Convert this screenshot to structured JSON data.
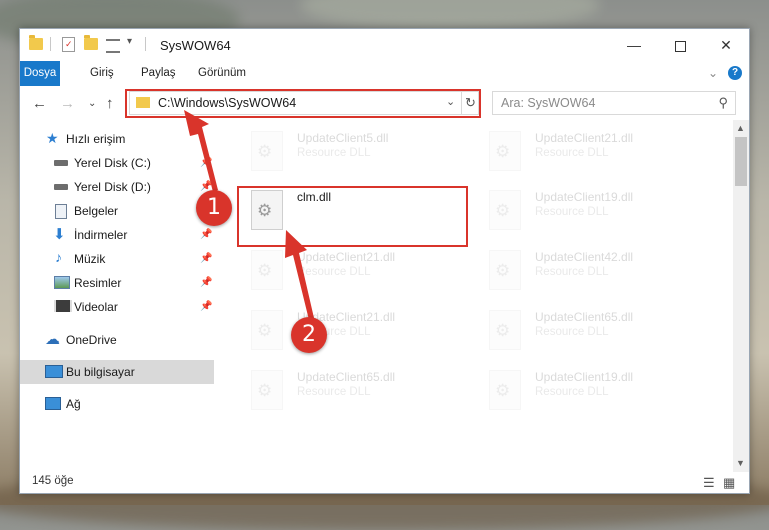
{
  "titlebar": {
    "title": "SysWOW64",
    "minimize_icon": "minimize-icon",
    "maximize_icon": "maximize-icon",
    "close_icon": "close-icon"
  },
  "ribbon": {
    "tabs": [
      {
        "label": "Dosya",
        "active": true
      },
      {
        "label": "Giriş"
      },
      {
        "label": "Paylaş"
      },
      {
        "label": "Görünüm"
      }
    ],
    "help_label": "?"
  },
  "navbar": {
    "address": "C:\\Windows\\SysWOW64",
    "search_placeholder": "Ara: SysWOW64"
  },
  "sidebar": {
    "items": [
      {
        "label": "Hızlı erişim",
        "icon": "star-icon"
      },
      {
        "label": "Yerel Disk (C:)",
        "icon": "drive-icon",
        "pinned": true
      },
      {
        "label": "Yerel Disk (D:)",
        "icon": "drive-icon",
        "pinned": true
      },
      {
        "label": "Belgeler",
        "icon": "documents-icon",
        "pinned": true
      },
      {
        "label": "İndirmeler",
        "icon": "download-icon",
        "pinned": true
      },
      {
        "label": "Müzik",
        "icon": "music-icon",
        "pinned": true
      },
      {
        "label": "Resimler",
        "icon": "pictures-icon",
        "pinned": true
      },
      {
        "label": "Videolar",
        "icon": "videos-icon",
        "pinned": true
      },
      {
        "label": "OneDrive",
        "icon": "cloud-icon"
      },
      {
        "label": "Bu bilgisayar",
        "icon": "computer-icon",
        "selected": true
      },
      {
        "label": "Ağ",
        "icon": "network-icon"
      }
    ]
  },
  "files": [
    {
      "name": "UpdateClient5.dll",
      "type": "Resource DLL"
    },
    {
      "name": "UpdateClient21.dll",
      "type": "Resource DLL"
    },
    {
      "name": "clm.dll",
      "type": ""
    },
    {
      "name": "UpdateClient19.dll",
      "type": "Resource DLL"
    },
    {
      "name": "UpdateClient21.dll",
      "type": "Resource DLL"
    },
    {
      "name": "UpdateClient42.dll",
      "type": "Resource DLL"
    },
    {
      "name": "UpdateClient21.dll",
      "type": "Resource DLL"
    },
    {
      "name": "UpdateClient65.dll",
      "type": "Resource DLL"
    },
    {
      "name": "UpdateClient65.dll",
      "type": "Resource DLL"
    },
    {
      "name": "UpdateClient19.dll",
      "type": "Resource DLL"
    }
  ],
  "status": {
    "item_count": "145 öğe"
  },
  "annotations": {
    "badge1": "1",
    "badge2": "2",
    "color": "#d9342b"
  }
}
